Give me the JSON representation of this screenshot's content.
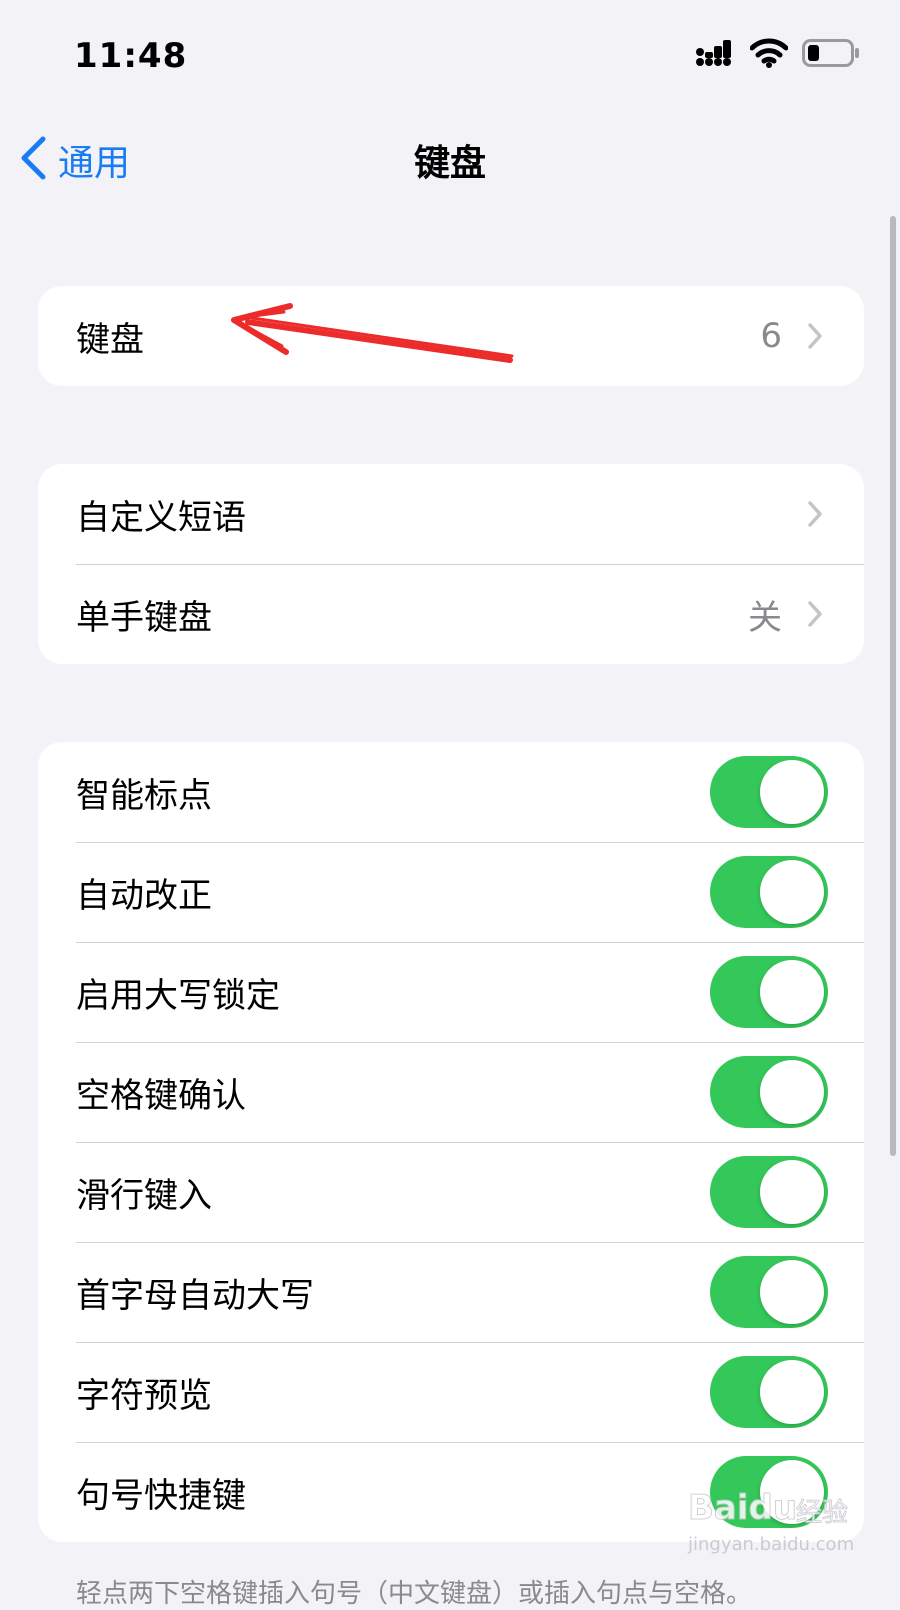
{
  "status_bar": {
    "time": "11:48"
  },
  "nav": {
    "back_label": "通用",
    "title": "键盘"
  },
  "group_keyboards": {
    "label": "键盘",
    "value": "6"
  },
  "group_text": {
    "items": [
      {
        "label": "自定义短语",
        "value": ""
      },
      {
        "label": "单手键盘",
        "value": "关"
      }
    ]
  },
  "group_toggles": {
    "items": [
      {
        "label": "智能标点",
        "on": true
      },
      {
        "label": "自动改正",
        "on": true
      },
      {
        "label": "启用大写锁定",
        "on": true
      },
      {
        "label": "空格键确认",
        "on": true
      },
      {
        "label": "滑行键入",
        "on": true
      },
      {
        "label": "首字母自动大写",
        "on": true
      },
      {
        "label": "字符预览",
        "on": true
      },
      {
        "label": "句号快捷键",
        "on": true
      }
    ]
  },
  "footer": {
    "text": "轻点两下空格键插入句号（中文键盘）或插入句点与空格。"
  },
  "watermark": {
    "brand": "Baidu",
    "cn": "经验",
    "url": "jingyan.baidu.com"
  },
  "colors": {
    "accent": "#1a7cf5",
    "toggle_on": "#34c759",
    "annotation": "#ec2b2b"
  }
}
